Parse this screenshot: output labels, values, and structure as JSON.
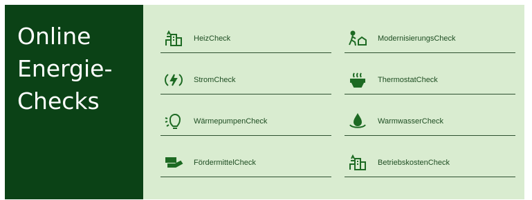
{
  "panel": {
    "title_lines": [
      "Online",
      "Energie-",
      "Checks"
    ]
  },
  "colors": {
    "panel_bg": "#0b4216",
    "content_bg": "#d9ecd0",
    "icon": "#1d6a23",
    "text": "#1e4d22"
  },
  "checks": [
    {
      "label": "HeizCheck",
      "icon": "building-icon"
    },
    {
      "label": "ModernisierungsCheck",
      "icon": "worker-icon"
    },
    {
      "label": "StromCheck",
      "icon": "lightning-icon"
    },
    {
      "label": "ThermostatCheck",
      "icon": "heat-icon"
    },
    {
      "label": "WärmepumpenCheck",
      "icon": "lightbulb-icon"
    },
    {
      "label": "WarmwasserCheck",
      "icon": "water-drop-icon"
    },
    {
      "label": "FördermittelCheck",
      "icon": "money-hand-icon"
    },
    {
      "label": "BetriebskostenCheck",
      "icon": "building-icon"
    }
  ]
}
